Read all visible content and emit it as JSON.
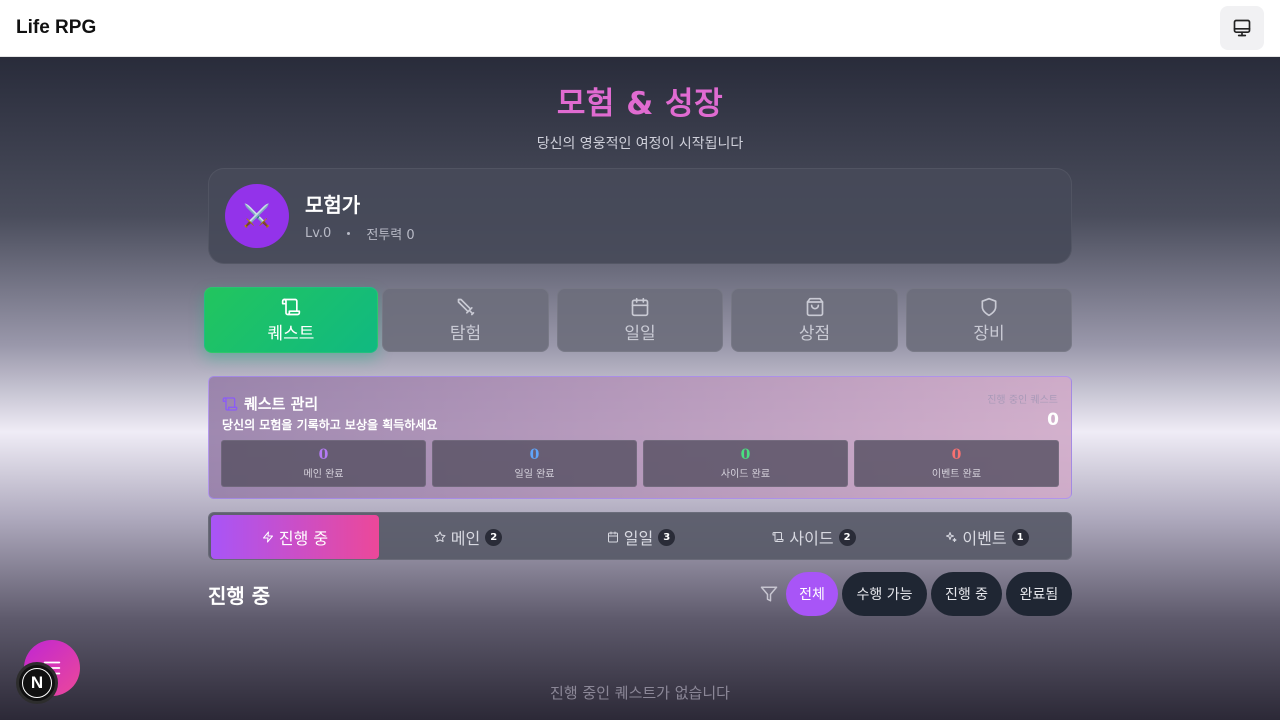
{
  "app": {
    "title": "Life RPG",
    "monitor_icon": "monitor-icon"
  },
  "hero": {
    "title": "모험 & 성장",
    "subtitle": "당신의 영웅적인 여정이 시작됩니다"
  },
  "profile": {
    "avatar_icon": "crossed-swords-icon",
    "avatar_glyph": "⚔️",
    "name": "모험가",
    "level": "Lv.0",
    "power": "전투력 0"
  },
  "nav": {
    "tabs": [
      {
        "label": "퀘스트",
        "icon": "scroll-icon",
        "active": true
      },
      {
        "label": "탐험",
        "icon": "sword-icon",
        "active": false
      },
      {
        "label": "일일",
        "icon": "calendar-icon",
        "active": false
      },
      {
        "label": "상점",
        "icon": "shopping-bag-icon",
        "active": false
      },
      {
        "label": "장비",
        "icon": "shield-icon",
        "active": false
      }
    ]
  },
  "quest_panel": {
    "title": "퀘스트 관리",
    "subtitle": "당신의 모험을 기록하고 보상을 획득하세요",
    "right_label": "진행 중인 퀘스트",
    "right_value": "0",
    "stats": [
      {
        "value": "0",
        "label": "메인 완료",
        "color": "#b57bf5"
      },
      {
        "value": "0",
        "label": "일일 완료",
        "color": "#60a5fa"
      },
      {
        "value": "0",
        "label": "사이드 완료",
        "color": "#4ade80"
      },
      {
        "value": "0",
        "label": "이벤트 완료",
        "color": "#f87171"
      }
    ]
  },
  "segments": [
    {
      "label": "진행 중",
      "icon": "zap-icon",
      "count": null,
      "active": true
    },
    {
      "label": "메인",
      "icon": "star-icon",
      "count": "2",
      "active": false
    },
    {
      "label": "일일",
      "icon": "calendar-icon",
      "count": "3",
      "active": false
    },
    {
      "label": "사이드",
      "icon": "scroll-icon",
      "count": "2",
      "active": false
    },
    {
      "label": "이벤트",
      "icon": "sparkles-icon",
      "count": "1",
      "active": false
    }
  ],
  "list": {
    "section_title": "진행 중",
    "filters": [
      {
        "label": "전체",
        "active": true
      },
      {
        "label": "수행 가능",
        "active": false
      },
      {
        "label": "진행 중",
        "active": false
      },
      {
        "label": "완료됨",
        "active": false
      }
    ],
    "empty_text": "진행 중인 퀘스트가 없습니다"
  },
  "floating": {
    "menu_icon": "menu-icon",
    "badge_letter": "N"
  }
}
